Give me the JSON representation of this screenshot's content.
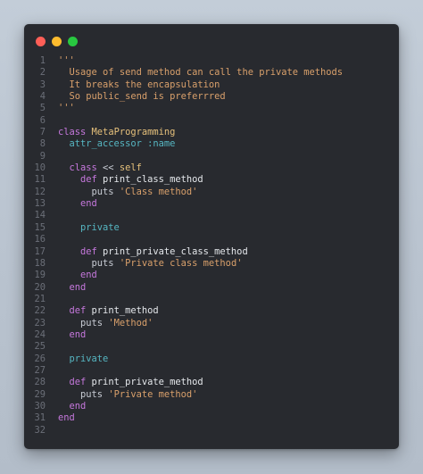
{
  "window": {
    "traffic_lights": [
      "close",
      "minimize",
      "zoom"
    ]
  },
  "code": {
    "lines": [
      {
        "n": "1",
        "tokens": [
          {
            "t": "'''",
            "k": "comment"
          }
        ]
      },
      {
        "n": "2",
        "tokens": [
          {
            "t": "  Usage of send method can call the private methods",
            "k": "comment"
          }
        ]
      },
      {
        "n": "3",
        "tokens": [
          {
            "t": "  It breaks the encapsulation",
            "k": "comment"
          }
        ]
      },
      {
        "n": "4",
        "tokens": [
          {
            "t": "  So public_send is preferrred",
            "k": "comment"
          }
        ]
      },
      {
        "n": "5",
        "tokens": [
          {
            "t": "'''",
            "k": "comment"
          }
        ]
      },
      {
        "n": "6",
        "tokens": []
      },
      {
        "n": "7",
        "tokens": [
          {
            "t": "class ",
            "k": "kw"
          },
          {
            "t": "MetaProgramming",
            "k": "const"
          }
        ]
      },
      {
        "n": "8",
        "tokens": [
          {
            "t": "  attr_accessor ",
            "k": "builtin"
          },
          {
            "t": ":name",
            "k": "sym"
          }
        ]
      },
      {
        "n": "9",
        "tokens": []
      },
      {
        "n": "10",
        "tokens": [
          {
            "t": "  class ",
            "k": "kw"
          },
          {
            "t": "<< ",
            "k": "op"
          },
          {
            "t": "self",
            "k": "self"
          }
        ]
      },
      {
        "n": "11",
        "tokens": [
          {
            "t": "    def ",
            "k": "kw"
          },
          {
            "t": "print_class_method",
            "k": "fn"
          }
        ]
      },
      {
        "n": "12",
        "tokens": [
          {
            "t": "      puts ",
            "k": "plain"
          },
          {
            "t": "'Class method'",
            "k": "str"
          }
        ]
      },
      {
        "n": "13",
        "tokens": [
          {
            "t": "    end",
            "k": "kw"
          }
        ]
      },
      {
        "n": "14",
        "tokens": []
      },
      {
        "n": "15",
        "tokens": [
          {
            "t": "    private",
            "k": "builtin"
          }
        ]
      },
      {
        "n": "16",
        "tokens": []
      },
      {
        "n": "17",
        "tokens": [
          {
            "t": "    def ",
            "k": "kw"
          },
          {
            "t": "print_private_class_method",
            "k": "fn"
          }
        ]
      },
      {
        "n": "18",
        "tokens": [
          {
            "t": "      puts ",
            "k": "plain"
          },
          {
            "t": "'Private class method'",
            "k": "str"
          }
        ]
      },
      {
        "n": "19",
        "tokens": [
          {
            "t": "    end",
            "k": "kw"
          }
        ]
      },
      {
        "n": "20",
        "tokens": [
          {
            "t": "  end",
            "k": "kw"
          }
        ]
      },
      {
        "n": "21",
        "tokens": []
      },
      {
        "n": "22",
        "tokens": [
          {
            "t": "  def ",
            "k": "kw"
          },
          {
            "t": "print_method",
            "k": "fn"
          }
        ]
      },
      {
        "n": "23",
        "tokens": [
          {
            "t": "    puts ",
            "k": "plain"
          },
          {
            "t": "'Method'",
            "k": "str"
          }
        ]
      },
      {
        "n": "24",
        "tokens": [
          {
            "t": "  end",
            "k": "kw"
          }
        ]
      },
      {
        "n": "25",
        "tokens": []
      },
      {
        "n": "26",
        "tokens": [
          {
            "t": "  private",
            "k": "builtin"
          }
        ]
      },
      {
        "n": "27",
        "tokens": []
      },
      {
        "n": "28",
        "tokens": [
          {
            "t": "  def ",
            "k": "kw"
          },
          {
            "t": "print_private_method",
            "k": "fn"
          }
        ]
      },
      {
        "n": "29",
        "tokens": [
          {
            "t": "    puts ",
            "k": "plain"
          },
          {
            "t": "'Private method'",
            "k": "str"
          }
        ]
      },
      {
        "n": "30",
        "tokens": [
          {
            "t": "  end",
            "k": "kw"
          }
        ]
      },
      {
        "n": "31",
        "tokens": [
          {
            "t": "end",
            "k": "kw"
          }
        ]
      },
      {
        "n": "32",
        "tokens": []
      }
    ]
  },
  "colors": {
    "background": "#282a2f",
    "close": "#ff5f57",
    "minimize": "#febc2e",
    "zoom": "#28c840",
    "comment": "#d9a06b",
    "keyword": "#c678dd",
    "constant": "#e6c07b",
    "builtin": "#56b6c2",
    "string": "#d9a06b",
    "line_number": "#6b6f78"
  }
}
